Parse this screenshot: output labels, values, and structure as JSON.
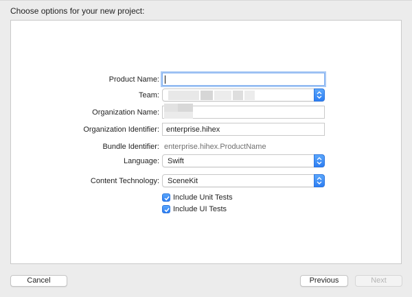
{
  "header": {
    "title": "Choose options for your new project:"
  },
  "form": {
    "product_name": {
      "label": "Product Name:",
      "value": ""
    },
    "team": {
      "label": "Team:",
      "value": ""
    },
    "organization_name": {
      "label": "Organization Name:",
      "value": ""
    },
    "organization_identifier": {
      "label": "Organization Identifier:",
      "value": "enterprise.hihex"
    },
    "bundle_identifier": {
      "label": "Bundle Identifier:",
      "value": "enterprise.hihex.ProductName"
    },
    "language": {
      "label": "Language:",
      "value": "Swift"
    },
    "content_technology": {
      "label": "Content Technology:",
      "value": "SceneKit"
    },
    "include_unit_tests": {
      "label": "Include Unit Tests",
      "checked": true
    },
    "include_ui_tests": {
      "label": "Include UI Tests",
      "checked": true
    }
  },
  "footer": {
    "cancel_label": "Cancel",
    "previous_label": "Previous",
    "next_label": "Next"
  },
  "colors": {
    "accent": "#3b8cf6",
    "focus_ring": "#a9c9f5",
    "background": "#ececec"
  }
}
